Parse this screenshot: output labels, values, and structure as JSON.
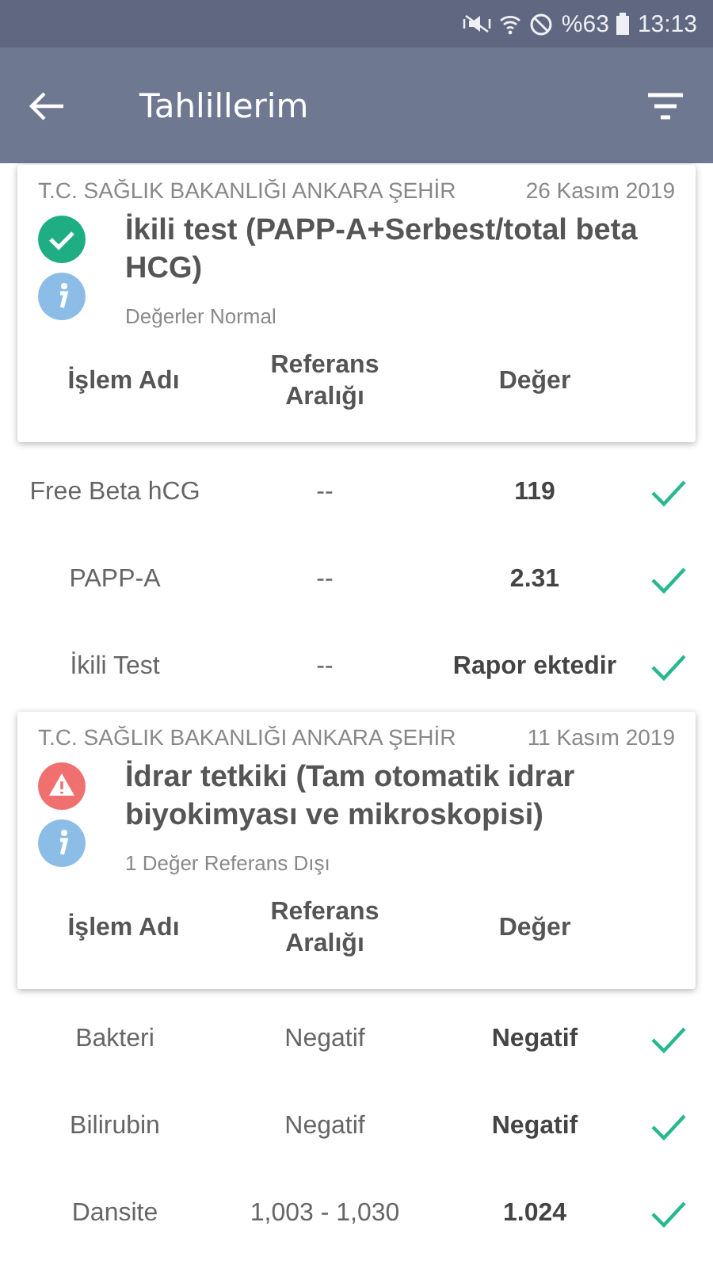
{
  "status_bar": {
    "battery": "%63",
    "time": "13:13"
  },
  "app_bar": {
    "title": "Tahlillerim"
  },
  "results": [
    {
      "source": "T.C. SAĞLIK BAKANLIĞI ANKARA ŞEHİR",
      "date": "26 Kasım 2019",
      "kind": "ok",
      "title": "İkili test (PAPP-A+Serbest/total beta HCG)",
      "summary": "Değerler Normal",
      "columns": [
        "İşlem Adı",
        "Referans Aralığı",
        "Değer"
      ],
      "rows": [
        {
          "name": "Free Beta hCG",
          "reference": "--",
          "value": "119",
          "in_range": true
        },
        {
          "name": "PAPP-A",
          "reference": "--",
          "value": "2.31",
          "in_range": true
        },
        {
          "name": "İkili Test",
          "reference": "--",
          "value": "Rapor ektedir",
          "in_range": true
        }
      ]
    },
    {
      "source": "T.C. SAĞLIK BAKANLIĞI ANKARA ŞEHİR",
      "date": "11 Kasım 2019",
      "kind": "warning",
      "title": "İdrar tetkiki (Tam otomatik idrar biyokimyası ve mikroskopisi)",
      "summary": "1 Değer Referans Dışı",
      "columns": [
        "İşlem Adı",
        "Referans Aralığı",
        "Değer"
      ],
      "rows": [
        {
          "name": "Bakteri",
          "reference": "Negatif",
          "value": "Negatif",
          "in_range": true
        },
        {
          "name": "Bilirubin",
          "reference": "Negatif",
          "value": "Negatif",
          "in_range": true
        },
        {
          "name": "Dansite",
          "reference": "1,003 - 1,030",
          "value": "1.024",
          "in_range": true
        }
      ]
    }
  ]
}
